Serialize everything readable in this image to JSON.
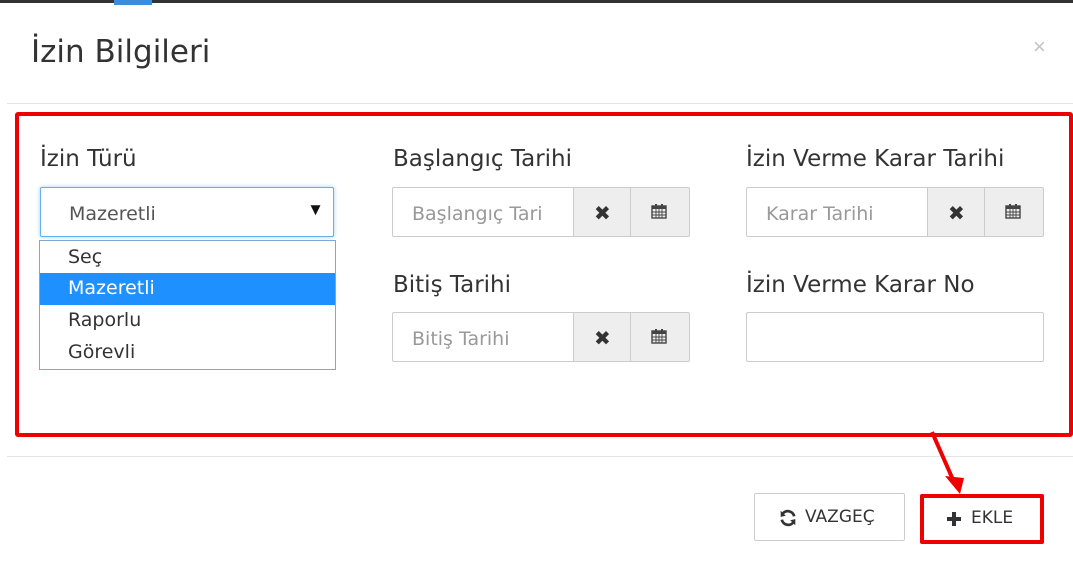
{
  "modal": {
    "title": "İzin Bilgileri",
    "close_label": "×"
  },
  "form": {
    "leave_type": {
      "label": "İzin Türü",
      "selected_value": "Mazeretli",
      "caret_glyph": "▼",
      "options": [
        "Seç",
        "Mazeretli",
        "Raporlu",
        "Görevli"
      ],
      "highlighted_option": "Mazeretli"
    },
    "start_date": {
      "label": "Başlangıç Tarihi",
      "placeholder": "Başlangıç Tari",
      "clear_glyph": "✖"
    },
    "end_date": {
      "label": "Bitiş Tarihi",
      "placeholder": "Bitiş Tarihi",
      "clear_glyph": "✖"
    },
    "decision_date": {
      "label": "İzin Verme Karar Tarihi",
      "placeholder": "Karar Tarihi",
      "clear_glyph": "✖"
    },
    "decision_no": {
      "label": "İzin Verme Karar No",
      "value": ""
    }
  },
  "footer": {
    "cancel_label": "VAZGEÇ",
    "cancel_icon": "refresh-icon",
    "add_label": "EKLE",
    "add_icon": "plus-icon"
  },
  "colors": {
    "annotation_red": "#ee0000",
    "selected_option_bg": "#1e90ff",
    "focus_border": "#66afe9"
  }
}
